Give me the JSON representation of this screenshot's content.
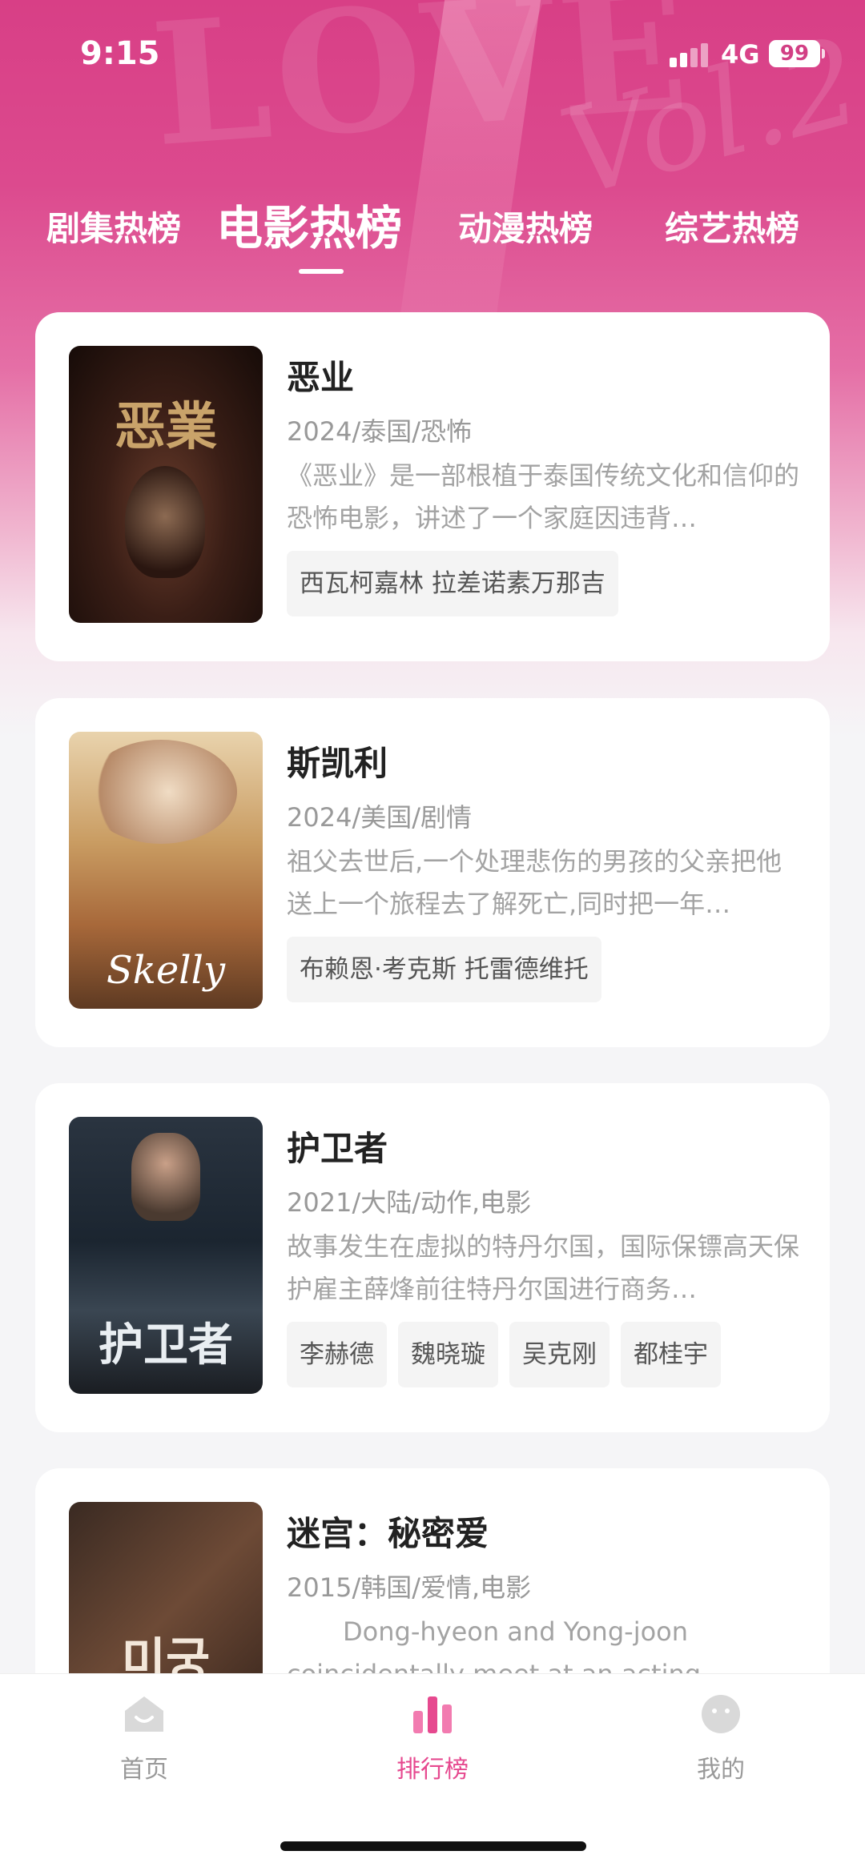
{
  "status": {
    "time": "9:15",
    "network": "4G",
    "battery": "99"
  },
  "tabs": [
    {
      "label": "剧集热榜"
    },
    {
      "label": "电影热榜"
    },
    {
      "label": "动漫热榜"
    },
    {
      "label": "综艺热榜"
    }
  ],
  "movies": [
    {
      "title": "恶业",
      "meta": "2024/泰国/恐怖",
      "desc": "《恶业》是一部根植于泰国传统文化和信仰的恐怖电影，讲述了一个家庭因违背…",
      "actors": [
        "西瓦柯嘉林 拉差诺素万那吉"
      ],
      "poster_text": "恶業"
    },
    {
      "title": "斯凯利",
      "meta": "2024/美国/剧情",
      "desc": "祖父去世后,一个处理悲伤的男孩的父亲把他送上一个旅程去了解死亡,同时把一年…",
      "actors": [
        "布赖恩·考克斯 托雷德维托"
      ],
      "poster_text": "Skelly"
    },
    {
      "title": "护卫者",
      "meta": "2021/大陆/动作,电影",
      "desc": "故事发生在虚拟的特丹尔国，国际保镖高天保护雇主薛烽前往特丹尔国进行商务…",
      "actors": [
        "李赫德",
        "魏晓璇",
        "吴克刚",
        "都桂宇"
      ],
      "poster_text": "护卫者"
    },
    {
      "title": "迷宫：秘密爱",
      "meta": "2015/韩国/爱情,电影",
      "desc": "Dong-hyeon and Yong-joon coincidentally meet at an acting …",
      "actors": [],
      "poster_text": "미궁"
    }
  ],
  "nav": {
    "home": "首页",
    "rank": "排行榜",
    "mine": "我的"
  },
  "colors": {
    "accent": "#e6498f",
    "hero": "#d83f86"
  }
}
